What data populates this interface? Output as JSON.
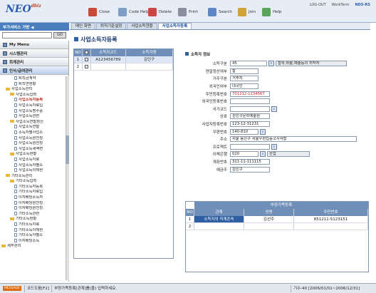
{
  "app": {
    "logo": "NEO",
    "logo_sub": "dbiz"
  },
  "toolbar": [
    {
      "label": "Close",
      "icon": "close-icon",
      "color": "#c84a36"
    },
    {
      "label": "Code Help",
      "icon": "code-help-icon",
      "color": "#7f9ec6"
    },
    {
      "label": "Delete",
      "icon": "delete-icon",
      "color": "#cc4646"
    },
    {
      "label": "Print",
      "icon": "print-icon",
      "color": "#8a8fa0"
    },
    {
      "label": "Search",
      "icon": "search-icon",
      "color": "#5c86c6"
    },
    {
      "label": "Join",
      "icon": "join-icon",
      "color": "#d1a334"
    },
    {
      "label": "Help",
      "icon": "help-icon",
      "color": "#5da45b"
    }
  ],
  "top_right": [
    "LOG-OUT",
    "WorkTerm",
    "NEO-RS"
  ],
  "sidebar": {
    "title": "부가서비스 가방",
    "go_label": "GO",
    "menus": [
      "My Menu",
      "시스템관리",
      "회계관리",
      "인사/급여관리"
    ]
  },
  "tree": [
    {
      "label": "퇴직금계약",
      "indent": 3,
      "kind": "doc"
    },
    {
      "label": "퇴직연현황",
      "indent": 3,
      "kind": "doc"
    },
    {
      "label": "사업소득관리",
      "indent": 1,
      "kind": "fold"
    },
    {
      "label": "사업소득입력",
      "indent": 2,
      "kind": "fold"
    },
    {
      "label": "사업소득자등록",
      "indent": 3,
      "kind": "doc",
      "sel": true
    },
    {
      "label": "사업소득자료입",
      "indent": 3,
      "kind": "doc"
    },
    {
      "label": "사업소득명수증",
      "indent": 3,
      "kind": "doc"
    },
    {
      "label": "사업소득관련",
      "indent": 3,
      "kind": "doc"
    },
    {
      "label": "사업소득연말정산",
      "indent": 2,
      "kind": "fold"
    },
    {
      "label": "사업소득연말",
      "indent": 3,
      "kind": "doc"
    },
    {
      "label": "소득자별사업소",
      "indent": 3,
      "kind": "doc"
    },
    {
      "label": "사업소득원천징",
      "indent": 3,
      "kind": "doc"
    },
    {
      "label": "사업소득원천징",
      "indent": 3,
      "kind": "doc"
    },
    {
      "label": "사업소득세액변",
      "indent": 3,
      "kind": "doc"
    },
    {
      "label": "사업소득현황",
      "indent": 2,
      "kind": "fold"
    },
    {
      "label": "사업소득자료",
      "indent": 3,
      "kind": "doc"
    },
    {
      "label": "사업소득자별소",
      "indent": 3,
      "kind": "doc"
    },
    {
      "label": "사업소득이체현",
      "indent": 3,
      "kind": "doc"
    },
    {
      "label": "기타소득관리",
      "indent": 1,
      "kind": "fold"
    },
    {
      "label": "기타소득입력",
      "indent": 2,
      "kind": "fold"
    },
    {
      "label": "기타소득자등록",
      "indent": 3,
      "kind": "doc"
    },
    {
      "label": "기타소득자료입",
      "indent": 3,
      "kind": "doc"
    },
    {
      "label": "이자배당소득자",
      "indent": 3,
      "kind": "doc"
    },
    {
      "label": "이자배당원천징",
      "indent": 3,
      "kind": "doc"
    },
    {
      "label": "이자배당원천징",
      "indent": 3,
      "kind": "doc"
    },
    {
      "label": "기타소득관련",
      "indent": 3,
      "kind": "doc"
    },
    {
      "label": "기타소득현황",
      "indent": 2,
      "kind": "fold"
    },
    {
      "label": "기타소득자료",
      "indent": 3,
      "kind": "doc"
    },
    {
      "label": "기타소득이체현",
      "indent": 3,
      "kind": "doc"
    },
    {
      "label": "기타소득자별소",
      "indent": 3,
      "kind": "doc"
    },
    {
      "label": "이자배당소득",
      "indent": 3,
      "kind": "doc"
    },
    {
      "label": "세무관리",
      "indent": 0,
      "kind": "fold"
    }
  ],
  "tabs": [
    "메인 화면",
    "퇴직기준설정",
    "사업소득현황",
    "사업소득자등록"
  ],
  "page_title": "사업소득자등록",
  "list": {
    "headers": [
      "NO",
      "",
      "소득자코드",
      "소득자명"
    ],
    "rows": [
      {
        "no": "1",
        "code": "A123456789",
        "name": "김인구"
      },
      {
        "no": "2",
        "code": "",
        "name": ""
      }
    ]
  },
  "form": {
    "section": "소득자 정보",
    "fields": [
      {
        "label": "소득구분",
        "value": "45",
        "extra": "잡학,학술,예술등의 저작자",
        "btn": true
      },
      {
        "label": "연말정산여부",
        "value": "함"
      },
      {
        "label": "거주구분",
        "value": "거주자"
      },
      {
        "label": "외국인여부",
        "value": "내국인"
      },
      {
        "label": "주민등록번호",
        "value": "701212-1234567",
        "red": true
      },
      {
        "label": "외국인등록번호",
        "value": ""
      },
      {
        "label": "국가코드",
        "value": "",
        "btn": true
      },
      {
        "label": "상호",
        "value": "김인구문학예술원"
      },
      {
        "label": "사업자등록번호",
        "value": "123-12-31231"
      },
      {
        "label": "우편번호",
        "value": "140-810",
        "btn": true
      },
      {
        "label": "주소",
        "value": "서울 용산구    서울우편집중국사서함"
      },
      {
        "label": "프로젝트",
        "value": "",
        "btn": true
      },
      {
        "label": "이체은행",
        "value": "020",
        "extra": "산업",
        "btn": true
      },
      {
        "label": "계좌번호",
        "value": "311-11-111115"
      },
      {
        "label": "예금주",
        "value": "김인구"
      }
    ]
  },
  "family": {
    "title": "부양가족등록",
    "headers": [
      "NO",
      "관계",
      "성명",
      "주민번호"
    ],
    "rows": [
      {
        "no": "1",
        "rel": "소득자의 직계존속",
        "name": "김선주",
        "rrn": "851211-5123151"
      },
      {
        "no": "2",
        "rel": "",
        "name": "",
        "rrn": ""
      }
    ]
  },
  "status": {
    "badge": "MESSAGE",
    "code_help": "코드도움[F2]",
    "message": "부양가족등록[관계]를(을) 입력하세요.",
    "period": "기수-40 [2006/01/01~2006/12/31]"
  }
}
